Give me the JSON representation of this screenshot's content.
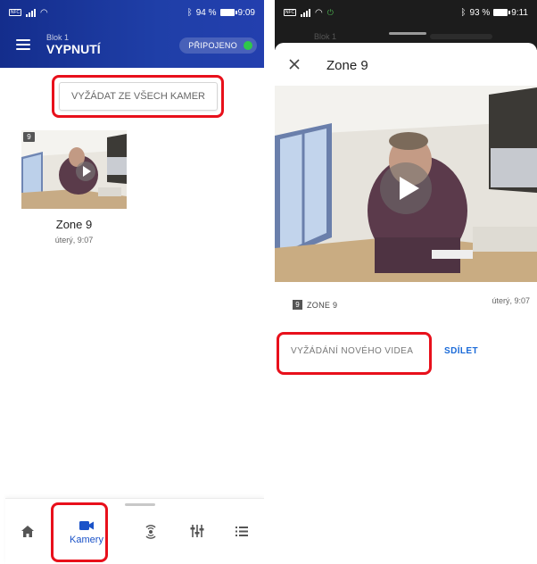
{
  "left": {
    "status": {
      "battery": "94 %",
      "time": "9:09"
    },
    "appbar": {
      "subtitle": "Blok 1",
      "title": "VYPNUTÍ",
      "connection": "PŘIPOJENO",
      "accent": "#1f3fa8",
      "connected_color": "#2ec84a"
    },
    "request_all_label": "VYŽÁDAT ZE VŠECH KAMER",
    "camera": {
      "badge": "9",
      "name": "Zone 9",
      "time": "úterý, 9:07"
    },
    "nav": {
      "items": [
        {
          "icon": "home-icon",
          "label": ""
        },
        {
          "icon": "camera-icon",
          "label": "Kamery",
          "active": true
        },
        {
          "icon": "sensor-icon",
          "label": ""
        },
        {
          "icon": "sliders-icon",
          "label": ""
        },
        {
          "icon": "list-icon",
          "label": ""
        }
      ],
      "active_color": "#1a52c8"
    }
  },
  "right": {
    "status": {
      "battery": "93 %",
      "time": "9:11"
    },
    "background_subtitle": "Blok 1",
    "sheet_title": "Zone 9",
    "badge": "9",
    "zone_label": "ZONE 9",
    "time": "úterý, 9:07",
    "request_new_label": "VYŽÁDÁNÍ NOVÉHO VIDEA",
    "share_label": "SDÍLET"
  },
  "highlight_color": "#e8101b"
}
